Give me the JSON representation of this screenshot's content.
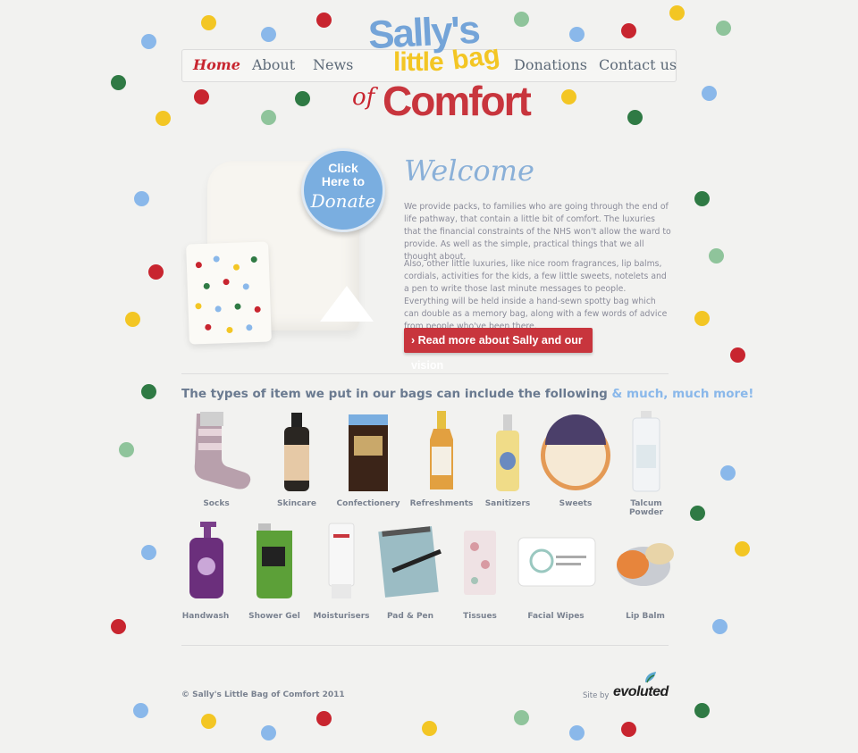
{
  "brand": {
    "logo_line1": "Sally's",
    "logo_line2a": "little",
    "logo_line2b": "bag",
    "logo_of": "of",
    "logo_line3": "Comfort"
  },
  "nav": {
    "items": [
      {
        "label": "Home",
        "active": true
      },
      {
        "label": "About"
      },
      {
        "label": "News"
      },
      {
        "label": "Donations"
      },
      {
        "label": "Contact us"
      }
    ]
  },
  "donate_badge": {
    "line1": "Click",
    "line2": "Here to",
    "line3": "Donate"
  },
  "welcome": {
    "title": "Welcome",
    "para1": "We provide packs, to families who are going through the end of life pathway, that contain a little bit of comfort. The luxuries that the financial constraints of the NHS won't allow the ward to provide. As well as the simple, practical things that we all thought about.",
    "para2": "Also, other little luxuries, like nice room fragrances, lip balms, cordials, activities for the kids, a few little sweets, notelets and a pen to write those last minute messages to people. Everything will be held inside a hand-sewn spotty bag which can double as a memory bag, along with a few words of advice from people who've been there.",
    "cta_label": "Read more about Sally and our vision"
  },
  "items_section": {
    "heading": "The types of item we put in our bags can include the following",
    "heading_more": "& much, much more!",
    "row1": [
      "Socks",
      "Skincare",
      "Confectionery",
      "Refreshments",
      "Sanitizers",
      "Sweets",
      "Talcum Powder"
    ],
    "row2": [
      "Handwash",
      "Shower Gel",
      "Moisturisers",
      "Pad & Pen",
      "Tissues",
      "Facial Wipes",
      "Lip Balm"
    ]
  },
  "footer": {
    "copyright": "© Sally's Little Bag of Comfort 2011",
    "site_by": "Site by",
    "agency": "evoluted"
  },
  "colors": {
    "red": "#c8252f",
    "blue": "#8ab8ea",
    "yellow": "#f3c624",
    "green": "#2f7a44",
    "sage": "#8fc49b"
  }
}
